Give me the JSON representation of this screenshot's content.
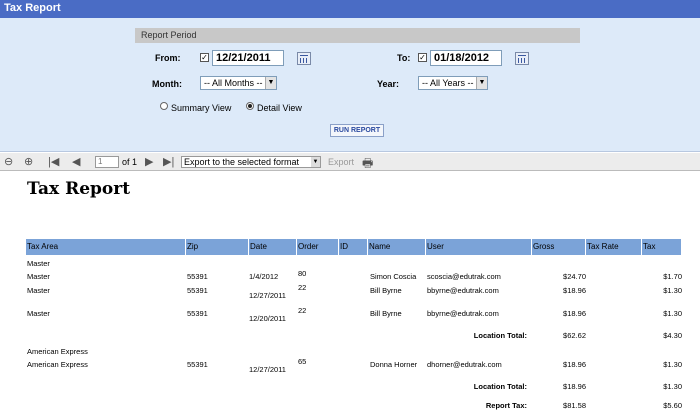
{
  "window": {
    "title": "Tax Report"
  },
  "params": {
    "section_title": "Report Period",
    "from_label": "From:",
    "from_value": "12/21/2011",
    "to_label": "To:",
    "to_value": "01/18/2012",
    "month_label": "Month:",
    "month_value": "-- All Months --",
    "year_label": "Year:",
    "year_value": "-- All Years --",
    "summary_label": "Summary View",
    "detail_label": "Detail View",
    "run_label": "RUN REPORT"
  },
  "toolbar": {
    "page_value": "1",
    "of_text": "of 1",
    "export_value": "Export to the selected format",
    "export_label": "Export"
  },
  "report": {
    "title": "Tax Report",
    "columns": [
      "Tax Area",
      "Zip",
      "Date",
      "Order",
      "ID",
      "Name",
      "User",
      "Gross",
      "Tax Rate",
      "Tax"
    ],
    "group1_label": "Master",
    "rows1": [
      {
        "area": "Master",
        "zip": "55391",
        "date": "1/4/2012",
        "order": "80",
        "name": "Simon Coscia",
        "user": "scoscia@edutrak.com",
        "gross": "$24.70",
        "tax": "$1.70"
      },
      {
        "area": "Master",
        "zip": "55391",
        "date": "12/27/2011",
        "order": "22",
        "name": "Bill Byrne",
        "user": "bbyrne@edutrak.com",
        "gross": "$18.96",
        "tax": "$1.30"
      },
      {
        "area": "Master",
        "zip": "55391",
        "date": "12/20/2011",
        "order": "22",
        "name": "Bill Byrne",
        "user": "bbyrne@edutrak.com",
        "gross": "$18.96",
        "tax": "$1.30"
      }
    ],
    "total1": {
      "label": "Location Total:",
      "gross": "$62.62",
      "tax": "$4.30"
    },
    "group2_label": "American Express",
    "rows2": [
      {
        "area": "American Express",
        "zip": "55391",
        "date": "12/27/2011",
        "order": "65",
        "name": "Donna Horner",
        "user": "dhorner@edutrak.com",
        "gross": "$18.96",
        "tax": "$1.30"
      }
    ],
    "total2": {
      "label": "Location Total:",
      "gross": "$18.96",
      "tax": "$1.30"
    },
    "report_total": {
      "label": "Report Tax:",
      "gross": "$81.58",
      "tax": "$5.60"
    }
  }
}
